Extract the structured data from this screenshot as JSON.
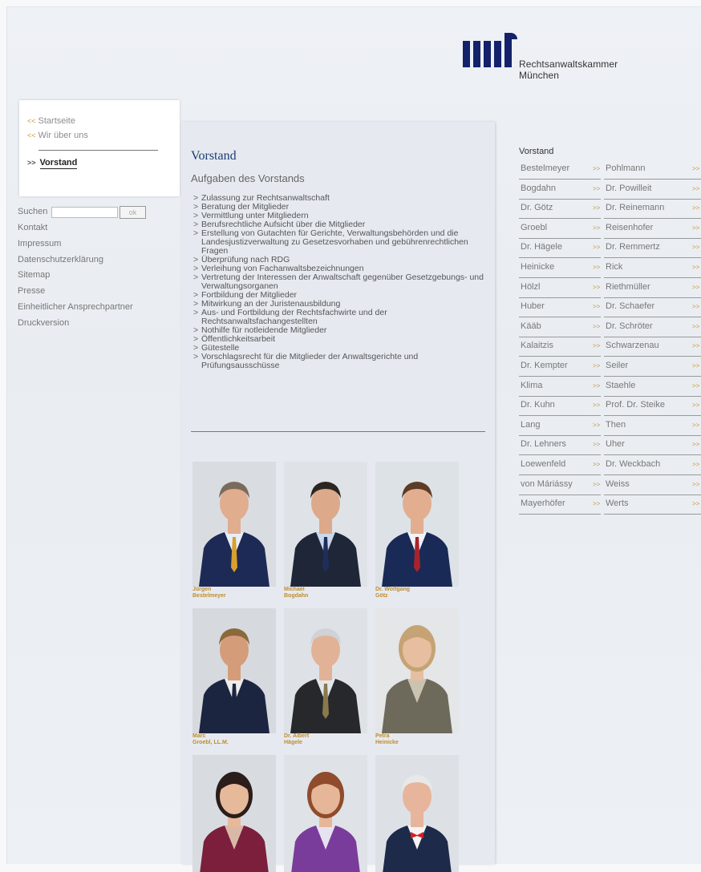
{
  "logo": {
    "line1": "Rechtsanwaltskammer",
    "line2": "München",
    "brand_color": "#13226b"
  },
  "nav": {
    "crumbs": [
      {
        "arrow": "<<",
        "label": "Startseite"
      },
      {
        "arrow": "<<",
        "label": "Wir über uns"
      }
    ],
    "active": {
      "arrow": ">>",
      "label": "Vorstand"
    }
  },
  "search": {
    "label": "Suchen",
    "value": "",
    "button": "ok"
  },
  "left_links": [
    "Kontakt",
    "Impressum",
    "Datenschutzerklärung",
    "Sitemap",
    "Presse",
    "Einheitlicher Ansprechpartner",
    "Druckversion"
  ],
  "main": {
    "title": "Vorstand",
    "subtitle": "Aufgaben des Vorstands",
    "duties": [
      "Zulassung zur Rechtsanwaltschaft",
      "Beratung der Mitglieder",
      "Vermittlung unter Mitgliedern",
      "Berufsrechtliche Aufsicht über die Mitglieder",
      "Erstellung von Gutachten für Gerichte, Verwaltungsbehörden und die Landesjustizverwaltung zu Gesetzesvorhaben und gebührenrechtlichen Fragen",
      "Überprüfung nach RDG",
      "Verleihung von Fachanwaltsbezeichnungen",
      "Vertretung der Interessen der Anwaltschaft gegenüber Gesetzgebungs- und Verwaltungsorganen",
      "Fortbildung der Mitglieder",
      "Mitwirkung an der Juristenausbildung",
      "Aus- und Fortbildung der Rechtsfachwirte und der Rechtsanwaltsfachangestellten",
      "Nothilfe für notleidende Mitglieder",
      "Öffentlichkeitsarbeit",
      "Gütestelle",
      "Vorschlagsrecht für die Mitglieder der Anwaltsgerichte und Prüfungsausschüsse"
    ]
  },
  "photos": [
    {
      "line1": "Jürgen",
      "line2": "Bestelmeyer"
    },
    {
      "line1": "Michael",
      "line2": "Bogdahn"
    },
    {
      "line1": "Dr. Wolfgang",
      "line2": "Götz"
    },
    {
      "line1": "Marc",
      "line2": "Groebl, LL.M."
    },
    {
      "line1": "Dr. Albert",
      "line2": "Hägele"
    },
    {
      "line1": "Petra",
      "line2": "Heinicke"
    },
    {
      "line1": "",
      "line2": ""
    },
    {
      "line1": "",
      "line2": ""
    },
    {
      "line1": "",
      "line2": ""
    }
  ],
  "vorstand": {
    "title": "Vorstand",
    "arrow": ">>",
    "col1": [
      "Bestelmeyer",
      "Bogdahn",
      "Dr. Götz",
      "Groebl",
      "Dr. Hägele",
      "Heinicke",
      "Hölzl",
      "Huber",
      "Kääb",
      "Kalaitzis",
      "Dr. Kempter",
      "Klima",
      "Dr. Kuhn",
      "Lang",
      "Dr. Lehners",
      "Loewenfeld",
      "von Máriássy",
      "Mayerhöfer"
    ],
    "col2": [
      "Pohlmann",
      "Dr. Powilleit",
      "Dr. Reinemann",
      "Reisenhofer",
      "Dr. Remmertz",
      "Rick",
      "Riethmüller",
      "Dr. Schaefer",
      "Dr. Schröter",
      "Schwarzenau",
      "Seiler",
      "Staehle",
      "Prof. Dr. Steike",
      "Then",
      "Uher",
      "Dr. Weckbach",
      "Weiss",
      "Werts"
    ]
  }
}
